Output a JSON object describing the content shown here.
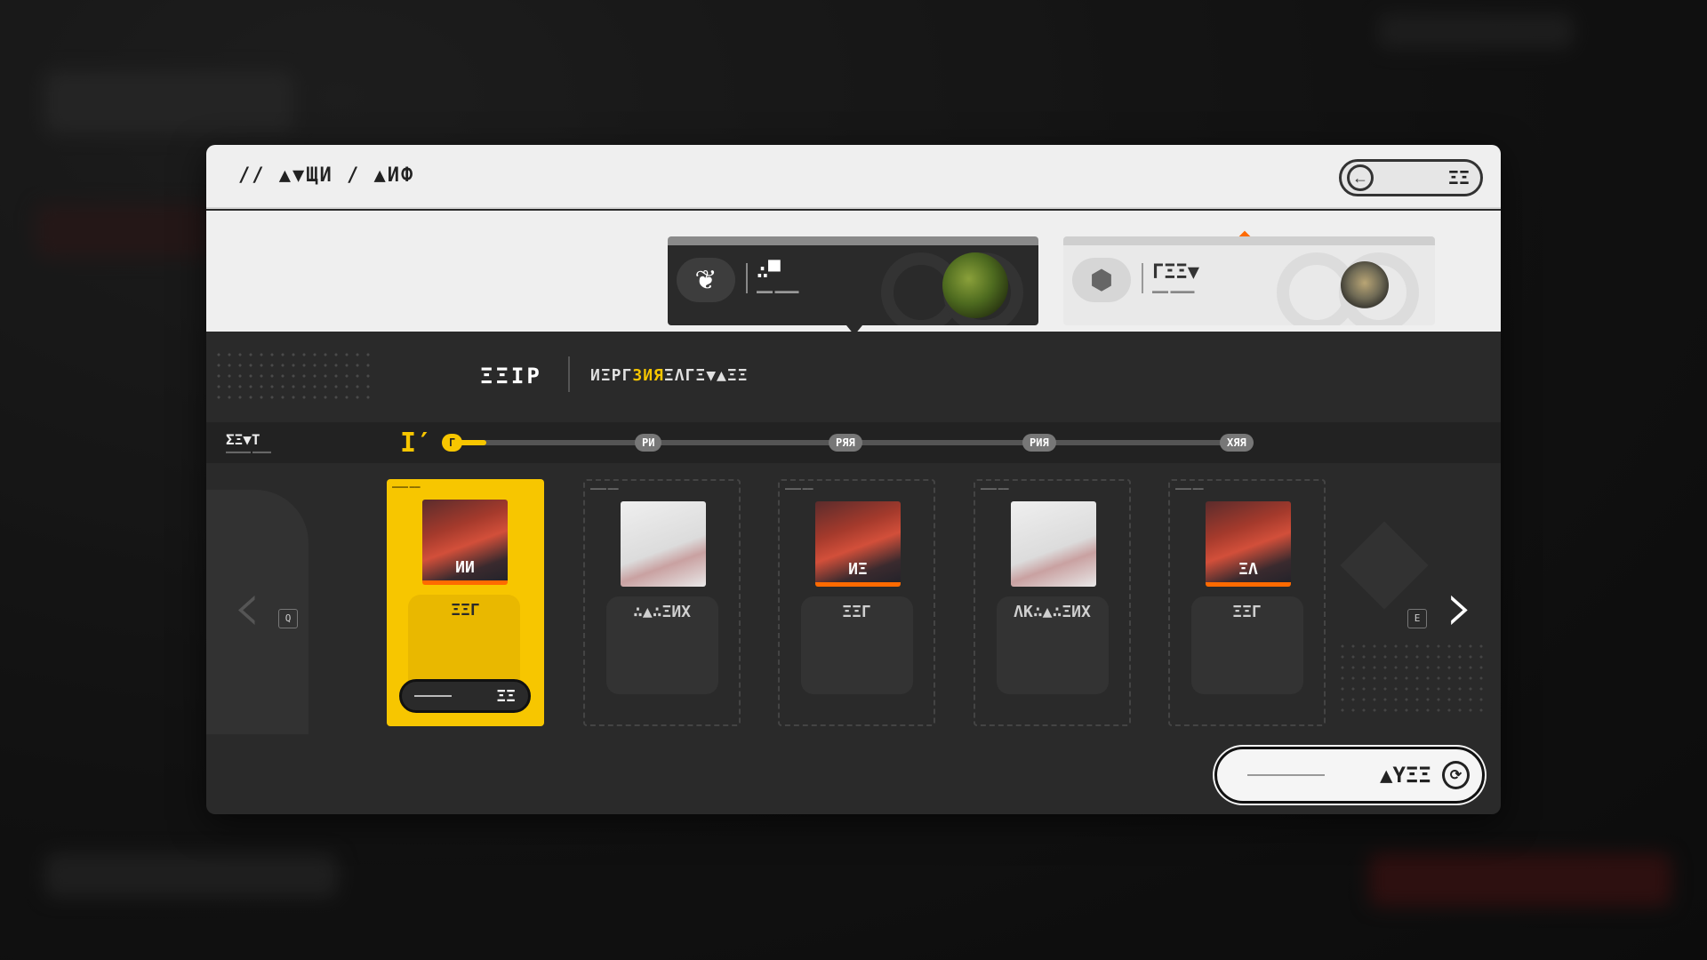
{
  "header": {
    "breadcrumb": "// ▲▼ЩИ / ▲ИФ",
    "back_label": "ΞΞ",
    "back_icon": "arrow-left-icon"
  },
  "select_cards": [
    {
      "name": "∴▀",
      "sub": "▬▬ ▬▬▬",
      "icon": "leaf-icon",
      "thumb": "bush",
      "active": true
    },
    {
      "name": "ΓΞΞ▼",
      "sub": "▬▬ ▬▬▬",
      "icon": "hexagon-icon",
      "thumb": "jar",
      "active": false
    }
  ],
  "title": {
    "main": "ΞΞΙΡ",
    "desc_before": "ИΞΡΓ",
    "desc_highlight": "ЗИЯ",
    "desc_after": "ΞΛΓΞ▼▲ΞΞ"
  },
  "track": {
    "label": "ΣΞ▼Τ",
    "label_sub": "▬▬▬▬ ▬▬▬",
    "icon": "Ӏ′",
    "progress": 0.05,
    "nodes": [
      "Γ",
      "ΡИ",
      "ΡЯЯ",
      "ΡИЯ",
      "ΧЯЯ"
    ]
  },
  "rewards": [
    {
      "count": "ИИ",
      "name": "ΞΞΓ",
      "thumb": "crystal",
      "claimable": true,
      "tag": "▬▬▬ ▬▬"
    },
    {
      "count": "",
      "name": "∴▲∴ΞИΧ",
      "thumb": "doc",
      "claimable": false,
      "tag": "▬▬▬ ▬▬"
    },
    {
      "count": "ИΞ",
      "name": "ΞΞΓ",
      "thumb": "crystal",
      "claimable": false,
      "tag": "▬▬▬ ▬▬"
    },
    {
      "count": "",
      "name": "ΛΚ∴▲∴ΞИΧ",
      "thumb": "doc",
      "claimable": false,
      "tag": "▬▬▬ ▬▬"
    },
    {
      "count": "ΞΛ",
      "name": "ΞΞΓ",
      "thumb": "crystal",
      "claimable": false,
      "tag": "▬▬▬ ▬▬"
    }
  ],
  "claim_label": "ΞΞ",
  "nav": {
    "prev_key": "Q",
    "next_key": "E"
  },
  "claim_all": {
    "label": "▲ΥΞΞ",
    "icon": "refresh-icon"
  },
  "colors": {
    "accent": "#f7c600",
    "highlight": "#ff6a00",
    "panel": "#2a2a2a",
    "header": "#efefef"
  }
}
